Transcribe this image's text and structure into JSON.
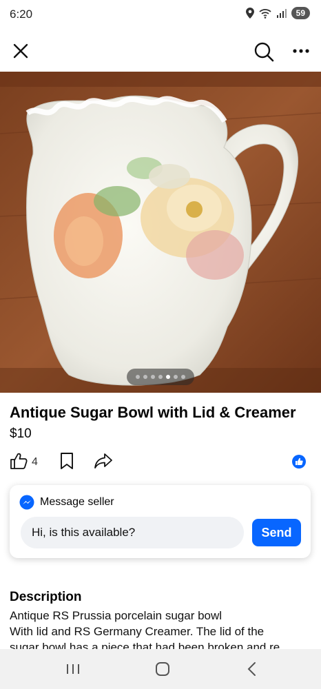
{
  "status_bar": {
    "time": "6:20",
    "battery": "59",
    "icons": [
      "location-icon",
      "wifi-icon",
      "signal-icon",
      "battery-icon"
    ]
  },
  "top_bar": {
    "icons": [
      "close-icon",
      "search-icon",
      "more-icon"
    ]
  },
  "gallery": {
    "photo_count": 7,
    "active_index": 4
  },
  "listing": {
    "title": "Antique Sugar Bowl with Lid & Creamer",
    "price": "$10",
    "like_count": "4"
  },
  "message": {
    "header": "Message seller",
    "input_value": "Hi, is this available?",
    "send_label": "Send"
  },
  "description": {
    "heading": "Description",
    "line1": "Antique RS Prussia porcelain sugar bowl",
    "line2": "With lid and RS Germany Creamer.  The lid of the",
    "line3": "sugar bowl has a piece that had been broken and re"
  },
  "colors": {
    "accent": "#0866ff",
    "table": "#8a4a26",
    "porcelain": "#f3f1ea"
  }
}
